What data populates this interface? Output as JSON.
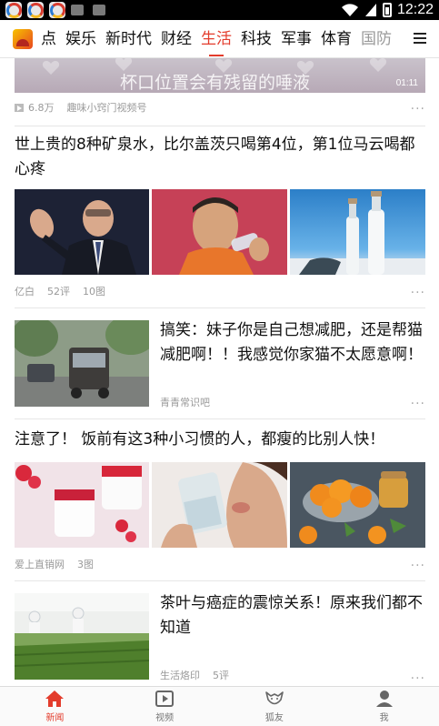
{
  "status_bar": {
    "time": "12:22",
    "icons": [
      "app-icon",
      "app-icon",
      "app-icon",
      "notification-icon",
      "notification-icon",
      "wifi-icon",
      "signal-icon",
      "battery-icon"
    ]
  },
  "channel_bar": {
    "channels": [
      {
        "label": "点",
        "active": false
      },
      {
        "label": "娱乐",
        "active": false
      },
      {
        "label": "新时代",
        "active": false
      },
      {
        "label": "财经",
        "active": false
      },
      {
        "label": "生活",
        "active": true
      },
      {
        "label": "科技",
        "active": false
      },
      {
        "label": "军事",
        "active": false
      },
      {
        "label": "体育",
        "active": false
      },
      {
        "label": "国防",
        "active": false
      }
    ],
    "accent_color": "#e33c2c"
  },
  "feed": {
    "video_item": {
      "caption": "杯口位置会有残留的唾液",
      "duration": "01:11",
      "views": "6.8万",
      "source": "趣味小窍门视频号"
    },
    "item1": {
      "title": "世上贵的8种矿泉水，比尔盖茨只喝第4位，第1位马云喝都心疼",
      "source": "亿白",
      "comments": "52评",
      "images": "10图"
    },
    "item2": {
      "title": "搞笑：妹子你是自己想减肥，还是帮猫减肥啊！！我感觉你家猫不太愿意啊！",
      "source": "青青常识吧"
    },
    "item3": {
      "title": "注意了！ 饭前有这3种小习惯的人，都瘦的比别人快！",
      "source": "爱上直销网",
      "images": "3图"
    },
    "item4": {
      "title": "茶叶与癌症的震惊关系！原来我们都不知道",
      "source": "生活烙印",
      "comments": "5评"
    },
    "more_label": "..."
  },
  "tab_bar": {
    "tabs": [
      {
        "label": "新闻",
        "icon": "home-icon",
        "active": true
      },
      {
        "label": "视频",
        "icon": "video-icon",
        "active": false
      },
      {
        "label": "狐友",
        "icon": "fox-icon",
        "active": false
      },
      {
        "label": "我",
        "icon": "person-icon",
        "active": false
      }
    ]
  }
}
